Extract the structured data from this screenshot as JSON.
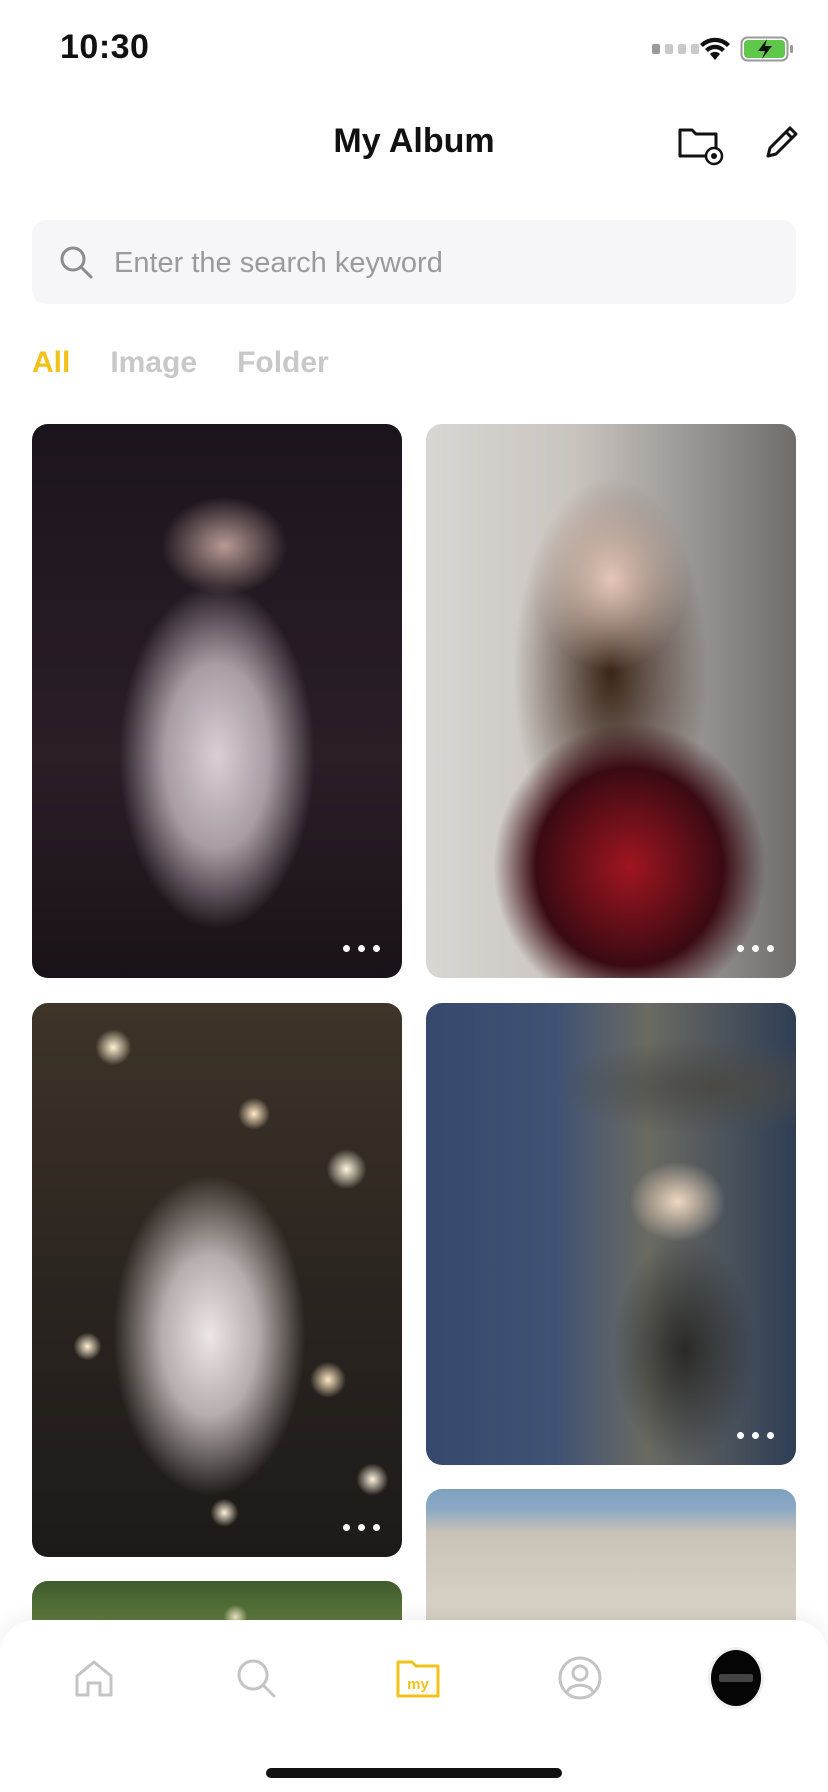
{
  "status_bar": {
    "time": "10:30"
  },
  "header": {
    "title": "My Album"
  },
  "search": {
    "placeholder": "Enter the search keyword"
  },
  "tabs": [
    {
      "label": "All",
      "active": true
    },
    {
      "label": "Image",
      "active": false
    },
    {
      "label": "Folder",
      "active": false
    }
  ],
  "colors": {
    "accent": "#f3c21a",
    "tab_inactive": "#c8c8c8",
    "search_bg": "#f6f6f8"
  },
  "album_items": [
    {
      "name": "photo-1",
      "icon": "more-icon"
    },
    {
      "name": "photo-2",
      "icon": "more-icon"
    },
    {
      "name": "photo-3",
      "icon": "more-icon"
    },
    {
      "name": "photo-4",
      "icon": "more-icon"
    },
    {
      "name": "photo-5"
    },
    {
      "name": "photo-6"
    }
  ],
  "bottom_nav": [
    {
      "icon": "home-icon",
      "active": false
    },
    {
      "icon": "search-icon",
      "active": false
    },
    {
      "icon": "my-folder-icon",
      "label": "my",
      "active": true
    },
    {
      "icon": "profile-icon",
      "active": false
    },
    {
      "icon": "avatar",
      "active": false
    }
  ]
}
